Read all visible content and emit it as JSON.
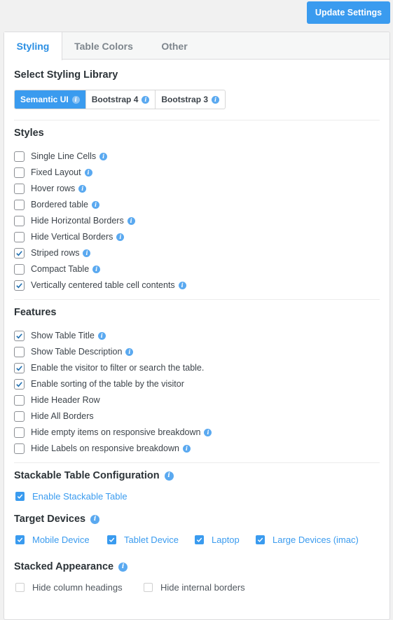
{
  "header": {
    "update_label": "Update Settings"
  },
  "tabs": [
    {
      "label": "Styling",
      "active": true
    },
    {
      "label": "Table Colors",
      "active": false
    },
    {
      "label": "Other",
      "active": false
    }
  ],
  "styling_library": {
    "title": "Select Styling Library",
    "options": [
      {
        "label": "Semantic UI",
        "selected": true
      },
      {
        "label": "Bootstrap 4",
        "selected": false
      },
      {
        "label": "Bootstrap 3",
        "selected": false
      }
    ]
  },
  "styles": {
    "title": "Styles",
    "items": [
      {
        "label": "Single Line Cells",
        "checked": false,
        "info": true
      },
      {
        "label": "Fixed Layout",
        "checked": false,
        "info": true
      },
      {
        "label": "Hover rows",
        "checked": false,
        "info": true
      },
      {
        "label": "Bordered table",
        "checked": false,
        "info": true
      },
      {
        "label": "Hide Horizontal Borders",
        "checked": false,
        "info": true
      },
      {
        "label": "Hide Vertical Borders",
        "checked": false,
        "info": true
      },
      {
        "label": "Striped rows",
        "checked": true,
        "info": true
      },
      {
        "label": "Compact Table",
        "checked": false,
        "info": true
      },
      {
        "label": "Vertically centered table cell contents",
        "checked": true,
        "info": true
      }
    ]
  },
  "features": {
    "title": "Features",
    "items": [
      {
        "label": "Show Table Title",
        "checked": true,
        "info": true
      },
      {
        "label": "Show Table Description",
        "checked": false,
        "info": true
      },
      {
        "label": "Enable the visitor to filter or search the table.",
        "checked": true,
        "info": false
      },
      {
        "label": "Enable sorting of the table by the visitor",
        "checked": true,
        "info": false
      },
      {
        "label": "Hide Header Row",
        "checked": false,
        "info": false
      },
      {
        "label": "Hide All Borders",
        "checked": false,
        "info": false
      },
      {
        "label": "Hide empty items on responsive breakdown",
        "checked": false,
        "info": true
      },
      {
        "label": "Hide Labels on responsive breakdown",
        "checked": false,
        "info": true
      }
    ]
  },
  "stackable": {
    "title": "Stackable Table Configuration",
    "enable_label": "Enable Stackable Table",
    "enable_checked": true,
    "target_title": "Target Devices",
    "devices": [
      {
        "label": "Mobile Device",
        "checked": true
      },
      {
        "label": "Tablet Device",
        "checked": true
      },
      {
        "label": "Laptop",
        "checked": true
      },
      {
        "label": "Large Devices (imac)",
        "checked": true
      }
    ],
    "appearance_title": "Stacked Appearance",
    "appearance": [
      {
        "label": "Hide column headings",
        "checked": false
      },
      {
        "label": "Hide internal borders",
        "checked": false
      }
    ]
  },
  "colors": {
    "accent": "#3a9bef",
    "checkmark": "#2271b1"
  },
  "icons": {
    "info": "info-icon",
    "check": "checkmark-icon"
  }
}
